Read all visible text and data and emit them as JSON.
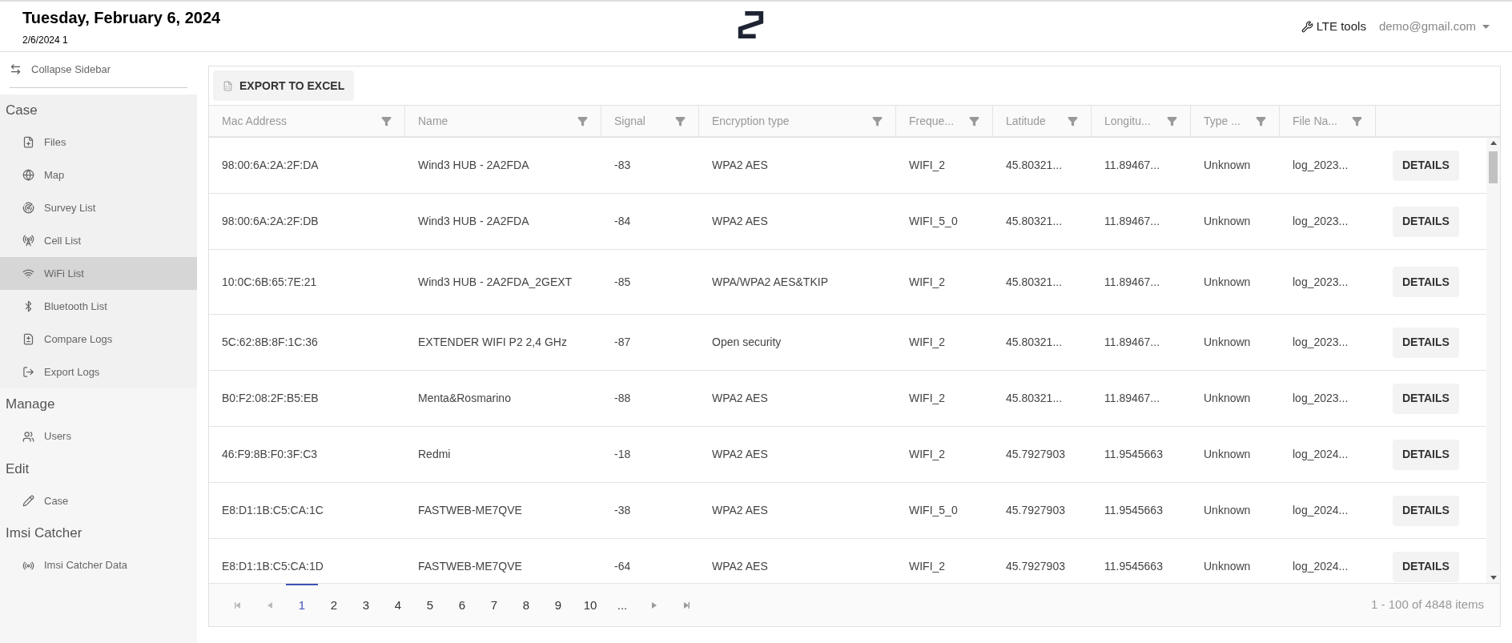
{
  "header": {
    "title": "Tuesday, February 6, 2024",
    "subtitle": "2/6/2024 1",
    "tools_link": "LTE tools",
    "user": "demo@gmail.com"
  },
  "sidebar": {
    "collapse_label": "Collapse Sidebar",
    "sections": [
      {
        "title": "Case",
        "items": [
          {
            "label": "Files",
            "selected": false
          },
          {
            "label": "Map",
            "selected": false
          },
          {
            "label": "Survey List",
            "selected": false
          },
          {
            "label": "Cell List",
            "selected": false
          },
          {
            "label": "WiFi List",
            "selected": true
          },
          {
            "label": "Bluetooth List",
            "selected": false
          },
          {
            "label": "Compare Logs",
            "selected": false
          },
          {
            "label": "Export Logs",
            "selected": false
          }
        ]
      },
      {
        "title": "Manage",
        "items": [
          {
            "label": "Users",
            "selected": false
          }
        ]
      },
      {
        "title": "Edit",
        "items": [
          {
            "label": "Case",
            "selected": false
          }
        ]
      },
      {
        "title": "Imsi Catcher",
        "items": [
          {
            "label": "Imsi Catcher Data",
            "selected": false
          }
        ]
      }
    ]
  },
  "toolbar": {
    "export_button": "EXPORT TO EXCEL"
  },
  "table": {
    "columns": [
      "Mac Address",
      "Name",
      "Signal",
      "Encryption type",
      "Freque...",
      "Latitude",
      "Longitu...",
      "Type ...",
      "File Na..."
    ],
    "rows": [
      {
        "cells": [
          "98:00:6A:2A:2F:DA",
          "Wind3 HUB - 2A2FDA",
          "-83",
          "WPA2 AES",
          "WIFI_2",
          "45.80321...",
          "11.89467...",
          "Unknown",
          "log_2023..."
        ],
        "action": "DETAILS"
      },
      {
        "cells": [
          "98:00:6A:2A:2F:DB",
          "Wind3 HUB - 2A2FDA",
          "-84",
          "WPA2 AES",
          "WIFI_5_0",
          "45.80321...",
          "11.89467...",
          "Unknown",
          "log_2023..."
        ],
        "action": "DETAILS"
      },
      {
        "cells": [
          "10:0C:6B:65:7E:21",
          "Wind3 HUB - 2A2FDA_2GEXT",
          "-85",
          "WPA/WPA2 AES&TKIP",
          "WIFI_2",
          "45.80321...",
          "11.89467...",
          "Unknown",
          "log_2023..."
        ],
        "action": "DETAILS"
      },
      {
        "cells": [
          "5C:62:8B:8F:1C:36",
          "EXTENDER WIFI P2 2,4 GHz",
          "-87",
          "Open security",
          "WIFI_2",
          "45.80321...",
          "11.89467...",
          "Unknown",
          "log_2023..."
        ],
        "action": "DETAILS"
      },
      {
        "cells": [
          "B0:F2:08:2F:B5:EB",
          "Menta&Rosmarino",
          "-88",
          "WPA2 AES",
          "WIFI_2",
          "45.80321...",
          "11.89467...",
          "Unknown",
          "log_2023..."
        ],
        "action": "DETAILS"
      },
      {
        "cells": [
          "46:F9:8B:F0:3F:C3",
          "Redmi",
          "-18",
          "WPA2 AES",
          "WIFI_2",
          "45.7927903",
          "11.9545663",
          "Unknown",
          "log_2024..."
        ],
        "action": "DETAILS"
      },
      {
        "cells": [
          "E8:D1:1B:C5:CA:1C",
          "FASTWEB-ME7QVE",
          "-38",
          "WPA2 AES",
          "WIFI_5_0",
          "45.7927903",
          "11.9545663",
          "Unknown",
          "log_2024..."
        ],
        "action": "DETAILS"
      },
      {
        "cells": [
          "E8:D1:1B:C5:CA:1D",
          "FASTWEB-ME7QVE",
          "-64",
          "WPA2 AES",
          "WIFI_2",
          "45.7927903",
          "11.9545663",
          "Unknown",
          "log_2024..."
        ],
        "action": "DETAILS"
      }
    ]
  },
  "pager": {
    "pages": [
      {
        "label": "1",
        "selected": true
      },
      {
        "label": "2",
        "selected": false
      },
      {
        "label": "3",
        "selected": false
      },
      {
        "label": "4",
        "selected": false
      },
      {
        "label": "5",
        "selected": false
      },
      {
        "label": "6",
        "selected": false
      },
      {
        "label": "7",
        "selected": false
      },
      {
        "label": "8",
        "selected": false
      },
      {
        "label": "9",
        "selected": false
      },
      {
        "label": "10",
        "selected": false
      },
      {
        "label": "...",
        "selected": false
      }
    ],
    "summary": "1 - 100 of 4848 items"
  }
}
